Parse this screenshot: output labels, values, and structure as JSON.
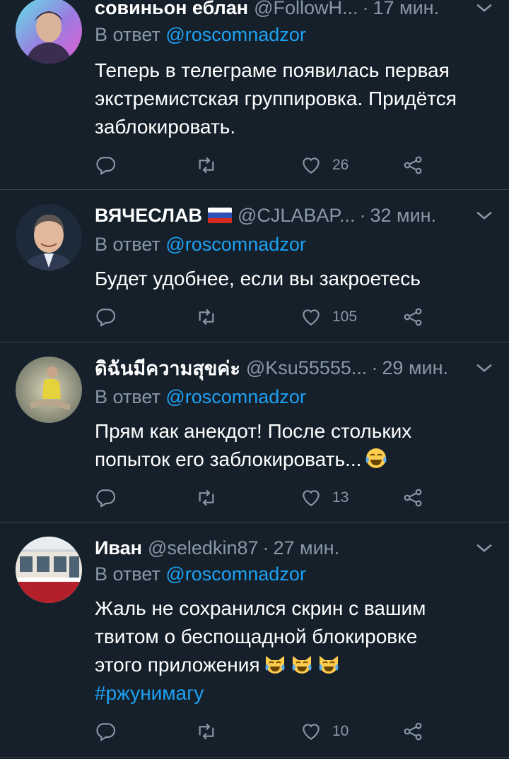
{
  "tweets": [
    {
      "name": "совиньон еблан",
      "handle": "@FollowH...",
      "time": "17 мин.",
      "reply_prefix": "В ответ",
      "reply_to": "@roscomnadzor",
      "text_lines": [
        "Теперь в телеграме появилась первая",
        "экстремистская группировка. Придётся",
        "заблокировать."
      ],
      "likes": "26"
    },
    {
      "name": "ВЯЧЕСЛАВ",
      "handle": "@CJLABAP...",
      "time": "32 мин.",
      "reply_prefix": "В ответ",
      "reply_to": "@roscomnadzor",
      "text_lines": [
        "Будет удобнее, если вы закроетесь"
      ],
      "likes": "105"
    },
    {
      "name": "ดิฉันมีความสุขค่ะ",
      "handle": "@Ksu55555...",
      "time": "29 мин.",
      "reply_prefix": "В ответ",
      "reply_to": "@roscomnadzor",
      "text_lines": [
        "Прям как анекдот! После стольких",
        "попыток его заблокировать..."
      ],
      "likes": "13"
    },
    {
      "name": "Иван",
      "handle": "@seledkin87",
      "time": "27 мин.",
      "reply_prefix": "В ответ",
      "reply_to": "@roscomnadzor",
      "text_lines": [
        "Жаль не сохранился скрин с вашим",
        "твитом о беспощадной блокировке",
        "этого приложения"
      ],
      "hashtag": "#ржунимагу",
      "likes": "10"
    }
  ],
  "icons": {
    "reply": "reply-icon",
    "retweet": "retweet-icon",
    "like": "heart-icon",
    "share": "share-icon",
    "menu": "chevron-down-icon"
  },
  "colors": {
    "background": "#15202b",
    "secondary_text": "#8899a6",
    "link": "#1da1f2",
    "divider": "#38444d"
  }
}
